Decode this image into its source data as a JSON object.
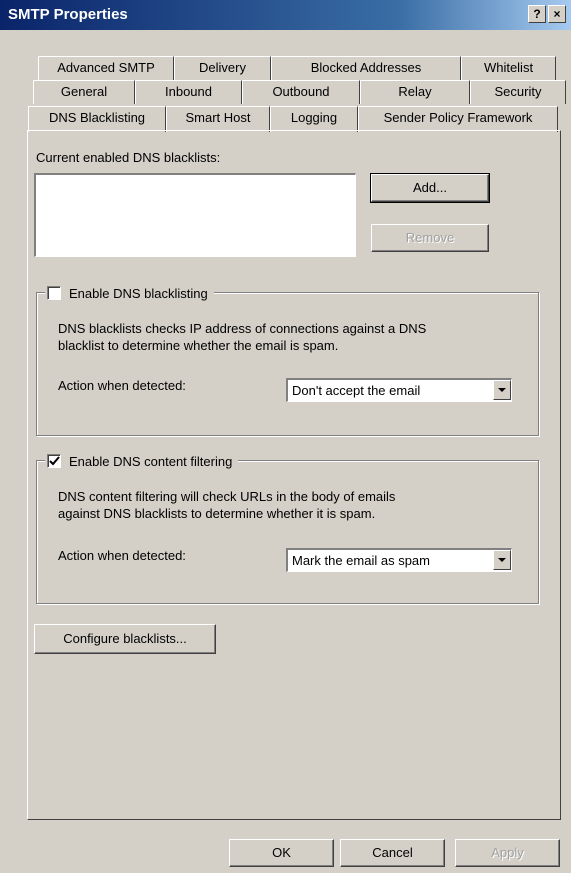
{
  "window": {
    "title": "SMTP Properties",
    "help_glyph": "?",
    "close_glyph": "×"
  },
  "tabs": {
    "row1": [
      "Advanced SMTP",
      "Delivery",
      "Blocked Addresses",
      "Whitelist"
    ],
    "row2": [
      "General",
      "Inbound",
      "Outbound",
      "Relay",
      "Security"
    ],
    "row3": [
      "DNS Blacklisting",
      "Smart Host",
      "Logging",
      "Sender Policy Framework"
    ],
    "active": "DNS Blacklisting"
  },
  "blacklists": {
    "label": "Current enabled DNS blacklists:",
    "items": [],
    "add_label": "Add...",
    "remove_label": "Remove"
  },
  "dns_blacklisting": {
    "checkbox_label": "Enable DNS blacklisting",
    "checked": false,
    "description_line1": "DNS blacklists checks IP address of connections against a DNS",
    "description_line2": "blacklist to determine whether the email is spam.",
    "action_label": "Action when detected:",
    "action_value": "Don't accept the email"
  },
  "dns_content_filtering": {
    "checkbox_label": "Enable DNS content filtering",
    "checked": true,
    "description_line1": "DNS content filtering will check URLs in the body of emails",
    "description_line2": "against DNS blacklists to determine whether it is spam.",
    "action_label": "Action when detected:",
    "action_value": "Mark the email as spam"
  },
  "configure_label": "Configure blacklists...",
  "footer": {
    "ok_label": "OK",
    "cancel_label": "Cancel",
    "apply_label": "Apply"
  },
  "colors": {
    "face": "#d4d0c8",
    "title_start": "#0a246a",
    "title_end": "#a6caf0"
  }
}
